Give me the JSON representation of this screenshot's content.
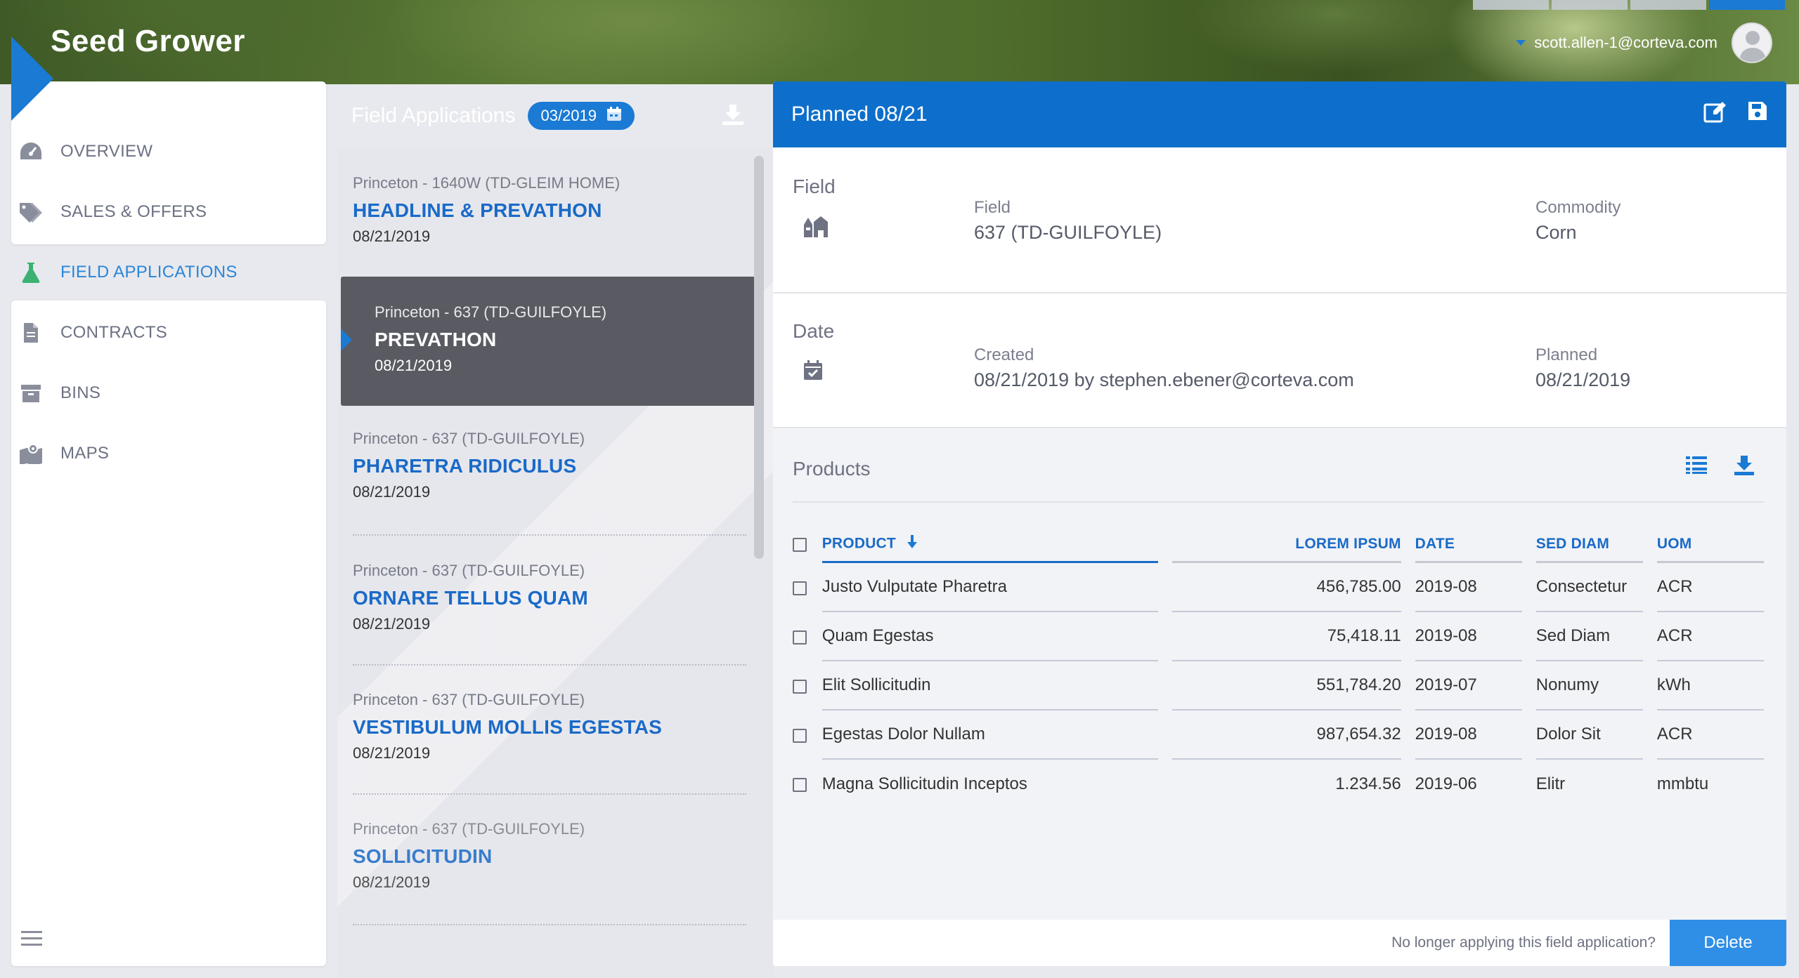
{
  "app": {
    "title": "Seed Grower",
    "user_email": "scott.allen-1@corteva.com"
  },
  "sidebar": {
    "items": [
      {
        "label": "OVERVIEW",
        "icon": "gauge-icon"
      },
      {
        "label": "SALES & OFFERS",
        "icon": "tag-icon"
      },
      {
        "label": "FIELD APPLICATIONS",
        "icon": "flask-icon",
        "active": true
      },
      {
        "label": "CONTRACTS",
        "icon": "document-icon"
      },
      {
        "label": "BINS",
        "icon": "archive-box-icon"
      },
      {
        "label": "MAPS",
        "icon": "map-icon"
      }
    ],
    "menu_icon": "hamburger-menu-icon"
  },
  "list": {
    "title": "Field Applications",
    "date_filter": "03/2019",
    "items": [
      {
        "location": "Princeton - 1640W (TD-GLEIM HOME)",
        "name": "HEADLINE & PREVATHON",
        "date": "08/21/2019"
      },
      {
        "location": "Princeton - 637 (TD-GUILFOYLE)",
        "name": "PREVATHON",
        "date": "08/21/2019",
        "selected": true
      },
      {
        "location": "Princeton - 637 (TD-GUILFOYLE)",
        "name": "PHARETRA RIDICULUS",
        "date": "08/21/2019"
      },
      {
        "location": "Princeton - 637 (TD-GUILFOYLE)",
        "name": "ORNARE TELLUS QUAM",
        "date": "08/21/2019"
      },
      {
        "location": "Princeton - 637 (TD-GUILFOYLE)",
        "name": "VESTIBULUM MOLLIS EGESTAS",
        "date": "08/21/2019"
      },
      {
        "location": "Princeton - 637 (TD-GUILFOYLE)",
        "name": "SOLLICITUDIN",
        "date": "08/21/2019"
      }
    ]
  },
  "detail": {
    "title": "Planned 08/21",
    "field_section": {
      "label": "Field",
      "field_key": "Field",
      "field_value": "637 (TD-GUILFOYLE)",
      "commodity_key": "Commodity",
      "commodity_value": "Corn"
    },
    "date_section": {
      "label": "Date",
      "created_key": "Created",
      "created_value": "08/21/2019 by stephen.ebener@corteva.com",
      "planned_key": "Planned",
      "planned_value": "08/21/2019"
    },
    "products": {
      "label": "Products",
      "columns": [
        "PRODUCT",
        "LOREM IPSUM",
        "DATE",
        "SED DIAM",
        "UOM"
      ],
      "rows": [
        [
          "Justo Vulputate Pharetra",
          "456,785.00",
          "2019-08",
          "Consectetur",
          "ACR"
        ],
        [
          "Quam Egestas",
          "75,418.11",
          "2019-08",
          "Sed Diam",
          "ACR"
        ],
        [
          "Elit Sollicitudin",
          "551,784.20",
          "2019-07",
          "Nonumy",
          "kWh"
        ],
        [
          "Egestas Dolor Nullam",
          "987,654.32",
          "2019-08",
          "Dolor Sit",
          "ACR"
        ],
        [
          "Magna Sollicitudin Inceptos",
          "1.234.56",
          "2019-06",
          "Elitr",
          "mmbtu"
        ]
      ]
    },
    "footer": {
      "prompt": "No longer applying this field application?",
      "delete_label": "Delete"
    }
  },
  "colors": {
    "accent": "#1a7ad4",
    "header_blue": "#0d6fcb",
    "link_blue": "#1a6ac8",
    "active_green": "#3bb273"
  }
}
